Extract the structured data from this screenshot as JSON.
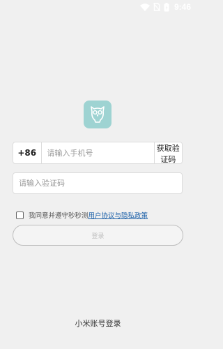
{
  "status_bar": {
    "time": "9:46",
    "icons": [
      "wifi-icon",
      "no-sim-icon",
      "battery-icon"
    ]
  },
  "app": {
    "logo_icon": "owl-icon",
    "logo_color": "#9ed3d2"
  },
  "phone": {
    "country_code": "+86",
    "placeholder": "请输入手机号",
    "value": "",
    "get_code_label": "获取验证码"
  },
  "verify_code": {
    "placeholder": "请输入验证码",
    "value": ""
  },
  "agreement": {
    "checked": false,
    "prefix": "我同意并遵守秒秒测",
    "link_text": "用户协议与隐私政策",
    "link_color": "#1a5fa8"
  },
  "login_button": {
    "label": "登录",
    "enabled": false
  },
  "alt_login": {
    "label": "小米账号登录"
  }
}
